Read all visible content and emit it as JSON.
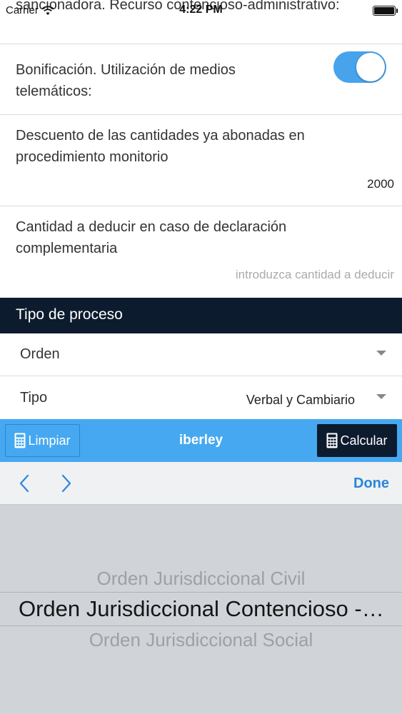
{
  "status_bar": {
    "carrier": "Carrier",
    "time": "4:22 PM"
  },
  "form": {
    "cut_label": "sancionadora. Recurso contencioso-administrativo:",
    "bonificacion": {
      "label": "Bonificación. Utilización de medios telemáticos:",
      "toggle_on": true
    },
    "descuento": {
      "label": "Descuento de las cantidades ya abonadas en procedimiento monitorio",
      "value": "2000"
    },
    "cantidad": {
      "label": "Cantidad a deducir en caso de declaración complementaria",
      "placeholder": "introduzca cantidad a deducir"
    }
  },
  "section": {
    "title": "Tipo de proceso"
  },
  "selects": {
    "orden": {
      "label": "Orden",
      "value": ""
    },
    "tipo": {
      "label": "Tipo",
      "value": "Verbal y Cambiario"
    }
  },
  "toolbar": {
    "limpiar": "Limpiar",
    "brand": "iberley",
    "calcular": "Calcular"
  },
  "accessory": {
    "done": "Done"
  },
  "picker": {
    "options": [
      "Orden Jurisdiccional Civil",
      "Orden Jurisdiccional Contencioso -…",
      "Orden Jurisdiccional Social"
    ],
    "selected_index": 1
  },
  "colors": {
    "accent_blue": "#46a8f0",
    "navy": "#0d1b2e",
    "done_blue": "#2a86dc"
  }
}
